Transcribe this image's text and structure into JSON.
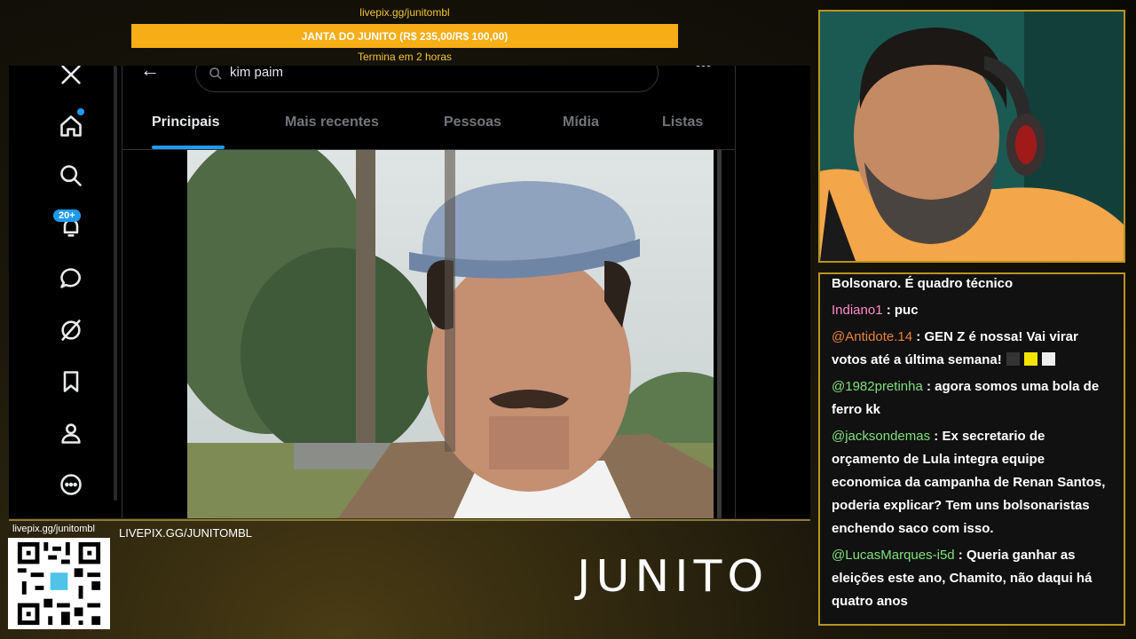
{
  "donation": {
    "link": "livepix.gg/junitombl",
    "goal": "JANTA DO JUNITO (R$ 235,00/R$ 100,00)",
    "ends": "Termina em 2 horas"
  },
  "twitter": {
    "search_value": "kim paim",
    "notif_count": "20+",
    "tabs": [
      "Principais",
      "Mais recentes",
      "Pessoas",
      "Mídia",
      "Listas"
    ],
    "active_tab": "Principais"
  },
  "chat": {
    "messages": [
      {
        "user": "",
        "text": "Bolsonaro. É quadro técnico",
        "color": "#ffffff"
      },
      {
        "user": "Indiano1",
        "text": " : puc",
        "color": "#ff8ac6"
      },
      {
        "user": "@Antidote.14",
        "text": " : GEN Z é nossa! Vai virar votos até a última semana!",
        "color": "#e8833a"
      },
      {
        "user": "@1982pretinha",
        "text": " : agora somos uma bola de ferro kk",
        "color": "#7fe07a"
      },
      {
        "user": "@jacksondemas",
        "text": " : Ex secretario de orçamento de Lula integra equipe economica da campanha de Renan Santos, poderia explicar? Tem uns bolsonaristas enchendo saco com isso.",
        "color": "#7fe07a"
      },
      {
        "user": "@LucasMarques-i5d",
        "text": " : Queria ganhar as eleições este ano, Chamito, não daqui há quatro anos",
        "color": "#7fe07a"
      }
    ]
  },
  "footer": {
    "qr_link": "livepix.gg/junitombl",
    "live_label": "LIVEPIX.GG/JUNITOMBL",
    "brand": "JUNITO"
  }
}
